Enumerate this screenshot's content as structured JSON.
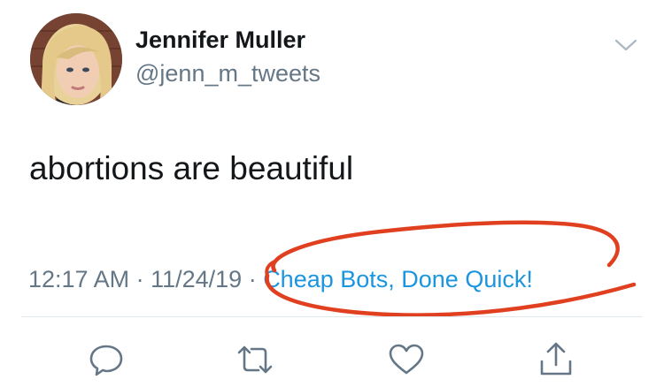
{
  "tweet": {
    "author": {
      "display_name": "Jennifer Muller",
      "handle": "@jenn_m_tweets",
      "avatar_icon": "profile-photo"
    },
    "text": "abortions are beautiful",
    "time": "12:17 AM",
    "separator": " · ",
    "date": "11/24/19",
    "source": "Cheap Bots, Done Quick!",
    "menu_icon": "chevron-down-icon"
  },
  "actions": [
    {
      "name": "reply",
      "icon": "speech-bubble-icon"
    },
    {
      "name": "retweet",
      "icon": "retweet-arrows-icon"
    },
    {
      "name": "like",
      "icon": "heart-icon"
    },
    {
      "name": "share",
      "icon": "share-upload-icon"
    }
  ],
  "colors": {
    "text_primary": "#14171a",
    "text_secondary": "#657786",
    "link": "#1b95e0",
    "icon": "#657786",
    "divider": "#e1e8ed",
    "annotation": "#e0401f"
  }
}
